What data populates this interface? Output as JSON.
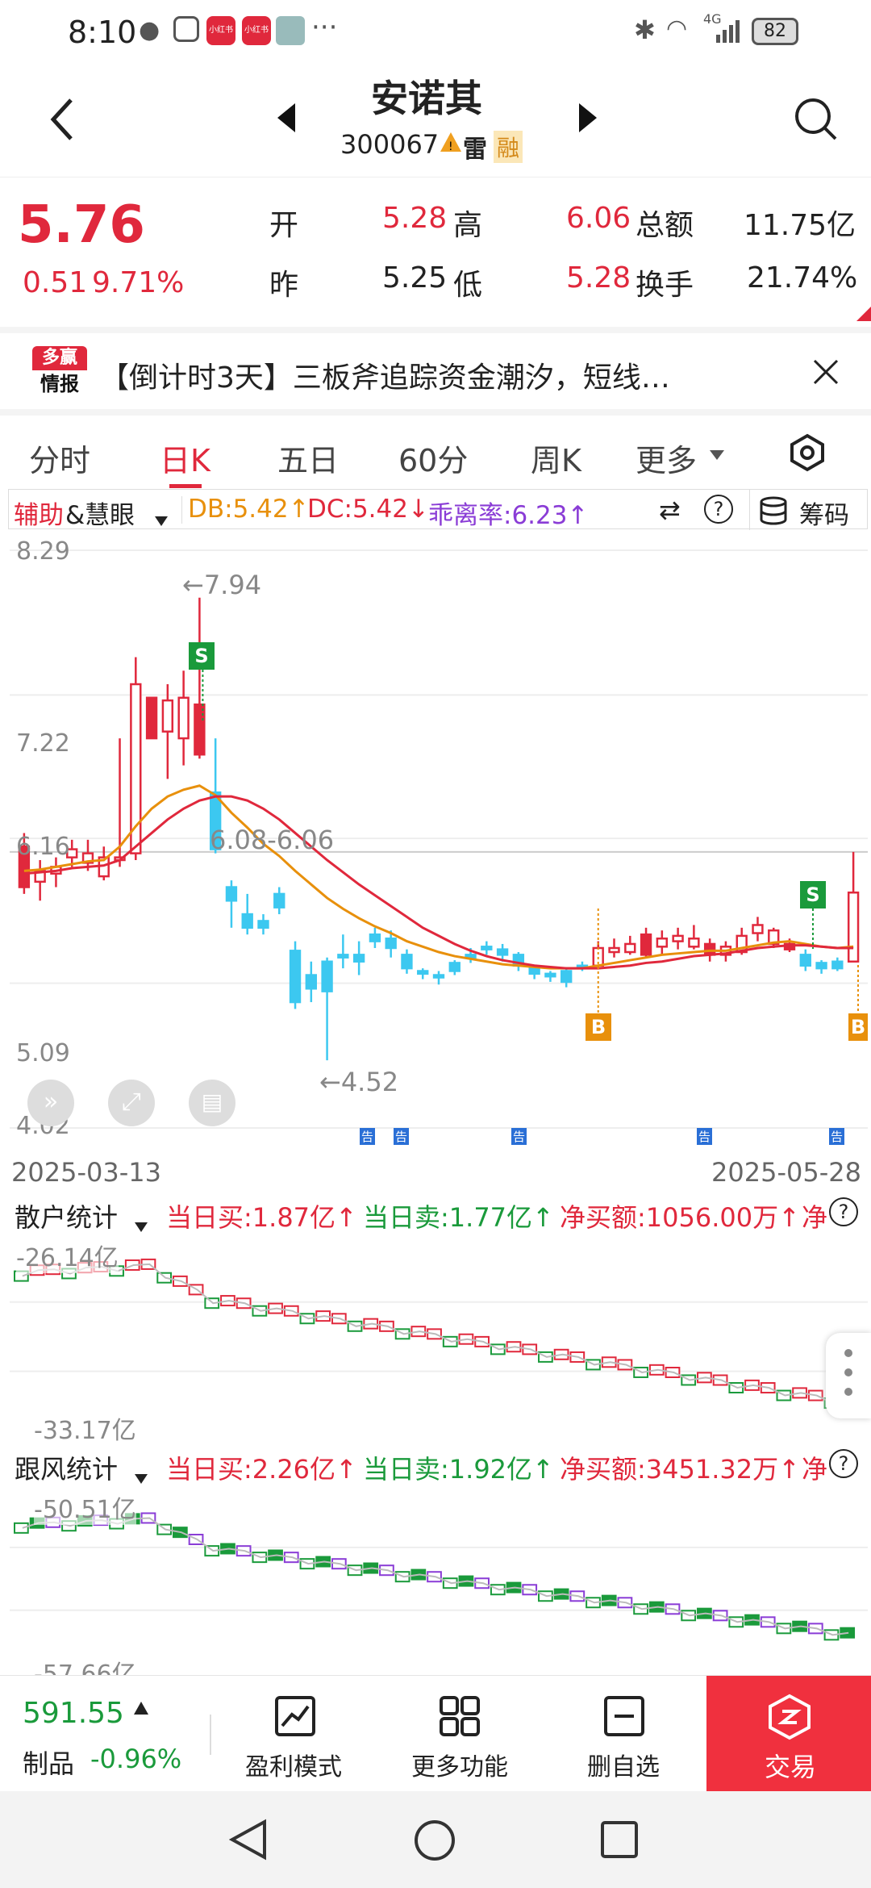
{
  "status": {
    "time": "8:10",
    "battery": "82",
    "signal": "4G",
    "more": "···",
    "app_badge": "小红书"
  },
  "header": {
    "title": "安诺其",
    "code": "300067",
    "tag1": "雷",
    "tag2": "融"
  },
  "quote": {
    "price": "5.76",
    "change": "0.51",
    "change_pct": "9.71%",
    "open_label": "开",
    "open": "5.28",
    "high_label": "高",
    "high": "6.06",
    "amount_label": "总额",
    "amount": "11.75亿",
    "prev_label": "昨",
    "prev": "5.25",
    "low_label": "低",
    "low": "5.28",
    "turnover_label": "换手",
    "turnover": "21.74%"
  },
  "banner": {
    "logo_top": "多赢",
    "logo_bottom": "情报",
    "text": "【倒计时3天】三板斧追踪资金潮汐，短线…"
  },
  "tabs": [
    "分时",
    "日K",
    "五日",
    "60分",
    "周K",
    "更多"
  ],
  "indicator": {
    "name_prefix": "辅助",
    "name_suffix": "&慧眼",
    "db": "DB:5.42↑",
    "dc": "DC:5.42↓",
    "bias": "乖离率:6.23↑",
    "chips": "筹码"
  },
  "chart_data": {
    "type": "candlestick",
    "y_labels": [
      "8.29",
      "7.22",
      "6.16",
      "5.09",
      "4.02"
    ],
    "ylim": [
      4.02,
      8.29
    ],
    "x_start": "2025-03-13",
    "x_end": "2025-05-28",
    "annotations": {
      "high": "←7.94",
      "low": "←4.52",
      "range": "6.08-6.06"
    },
    "signals": [
      "S",
      "B",
      "S",
      "B"
    ],
    "notice_marker": "告",
    "candles": [
      {
        "o": 6.1,
        "c": 5.8,
        "h": 6.2,
        "l": 5.75,
        "up": false,
        "red": true
      },
      {
        "o": 5.84,
        "c": 5.92,
        "h": 6.0,
        "l": 5.7,
        "up": true,
        "red": true
      },
      {
        "o": 5.9,
        "c": 5.95,
        "h": 6.02,
        "l": 5.8,
        "up": true,
        "red": true
      },
      {
        "o": 6.02,
        "c": 6.08,
        "h": 6.15,
        "l": 5.95,
        "up": true,
        "red": true
      },
      {
        "o": 5.98,
        "c": 6.05,
        "h": 6.15,
        "l": 5.92,
        "up": true,
        "red": true
      },
      {
        "o": 5.88,
        "c": 6.02,
        "h": 6.1,
        "l": 5.85,
        "up": true,
        "red": true
      },
      {
        "o": 6.0,
        "c": 6.02,
        "h": 6.9,
        "l": 5.95,
        "up": true,
        "red": true
      },
      {
        "o": 6.05,
        "c": 7.3,
        "h": 7.5,
        "l": 6.0,
        "up": true,
        "red": true
      },
      {
        "o": 7.2,
        "c": 6.9,
        "h": 7.2,
        "l": 6.9,
        "up": false,
        "red": true
      },
      {
        "o": 6.95,
        "c": 7.18,
        "h": 7.3,
        "l": 6.6,
        "up": true,
        "red": true
      },
      {
        "o": 6.9,
        "c": 7.2,
        "h": 7.4,
        "l": 6.7,
        "up": true,
        "red": true
      },
      {
        "o": 7.15,
        "c": 6.78,
        "h": 7.94,
        "l": 6.75,
        "up": false,
        "red": true
      },
      {
        "o": 6.5,
        "c": 6.08,
        "h": 6.9,
        "l": 6.05,
        "up": false,
        "red": false
      },
      {
        "o": 5.8,
        "c": 5.7,
        "h": 5.85,
        "l": 5.5,
        "up": false,
        "red": false
      },
      {
        "o": 5.6,
        "c": 5.5,
        "h": 5.75,
        "l": 5.45,
        "up": false,
        "red": false
      },
      {
        "o": 5.55,
        "c": 5.5,
        "h": 5.6,
        "l": 5.45,
        "up": false,
        "red": false
      },
      {
        "o": 5.75,
        "c": 5.65,
        "h": 5.8,
        "l": 5.6,
        "up": false,
        "red": false
      },
      {
        "o": 5.33,
        "c": 4.95,
        "h": 5.4,
        "l": 4.9,
        "up": false,
        "red": false
      },
      {
        "o": 5.15,
        "c": 5.05,
        "h": 5.25,
        "l": 4.95,
        "up": false,
        "red": false
      },
      {
        "o": 5.25,
        "c": 5.03,
        "h": 5.28,
        "l": 4.52,
        "up": false,
        "red": false
      },
      {
        "o": 5.3,
        "c": 5.28,
        "h": 5.45,
        "l": 5.2,
        "up": false,
        "red": false
      },
      {
        "o": 5.3,
        "c": 5.25,
        "h": 5.4,
        "l": 5.15,
        "up": false,
        "red": false
      },
      {
        "o": 5.45,
        "c": 5.4,
        "h": 5.5,
        "l": 5.35,
        "up": false,
        "red": false
      },
      {
        "o": 5.42,
        "c": 5.35,
        "h": 5.48,
        "l": 5.28,
        "up": false,
        "red": false
      },
      {
        "o": 5.3,
        "c": 5.2,
        "h": 5.34,
        "l": 5.16,
        "up": false,
        "red": false
      },
      {
        "o": 5.18,
        "c": 5.16,
        "h": 5.2,
        "l": 5.12,
        "up": false,
        "red": false
      },
      {
        "o": 5.15,
        "c": 5.14,
        "h": 5.18,
        "l": 5.08,
        "up": false,
        "red": false
      },
      {
        "o": 5.18,
        "c": 5.24,
        "h": 5.26,
        "l": 5.15,
        "up": false,
        "red": false
      },
      {
        "o": 5.28,
        "c": 5.3,
        "h": 5.35,
        "l": 5.24,
        "up": false,
        "red": false
      },
      {
        "o": 5.36,
        "c": 5.34,
        "h": 5.4,
        "l": 5.3,
        "up": false,
        "red": false
      },
      {
        "o": 5.34,
        "c": 5.3,
        "h": 5.38,
        "l": 5.25,
        "up": false,
        "red": false
      },
      {
        "o": 5.3,
        "c": 5.22,
        "h": 5.32,
        "l": 5.18,
        "up": false,
        "red": false
      },
      {
        "o": 5.2,
        "c": 5.16,
        "h": 5.22,
        "l": 5.12,
        "up": false,
        "red": false
      },
      {
        "o": 5.16,
        "c": 5.14,
        "h": 5.18,
        "l": 5.1,
        "up": false,
        "red": false
      },
      {
        "o": 5.18,
        "c": 5.1,
        "h": 5.2,
        "l": 5.06,
        "up": false,
        "red": false
      },
      {
        "o": 5.2,
        "c": 5.22,
        "h": 5.25,
        "l": 5.18,
        "up": false,
        "red": false
      },
      {
        "o": 5.22,
        "c": 5.35,
        "h": 5.4,
        "l": 5.2,
        "up": true,
        "red": true
      },
      {
        "o": 5.35,
        "c": 5.32,
        "h": 5.42,
        "l": 5.28,
        "up": true,
        "red": true
      },
      {
        "o": 5.32,
        "c": 5.38,
        "h": 5.44,
        "l": 5.3,
        "up": true,
        "red": true
      },
      {
        "o": 5.3,
        "c": 5.45,
        "h": 5.5,
        "l": 5.28,
        "up": false,
        "red": true
      },
      {
        "o": 5.36,
        "c": 5.42,
        "h": 5.48,
        "l": 5.3,
        "up": true,
        "red": true
      },
      {
        "o": 5.4,
        "c": 5.44,
        "h": 5.5,
        "l": 5.34,
        "up": true,
        "red": true
      },
      {
        "o": 5.36,
        "c": 5.42,
        "h": 5.52,
        "l": 5.34,
        "up": true,
        "red": true
      },
      {
        "o": 5.38,
        "c": 5.3,
        "h": 5.42,
        "l": 5.25,
        "up": false,
        "red": true
      },
      {
        "o": 5.3,
        "c": 5.36,
        "h": 5.4,
        "l": 5.25,
        "up": true,
        "red": true
      },
      {
        "o": 5.32,
        "c": 5.44,
        "h": 5.5,
        "l": 5.3,
        "up": true,
        "red": true
      },
      {
        "o": 5.46,
        "c": 5.52,
        "h": 5.58,
        "l": 5.4,
        "up": true,
        "red": true
      },
      {
        "o": 5.38,
        "c": 5.48,
        "h": 5.5,
        "l": 5.35,
        "up": true,
        "red": true
      },
      {
        "o": 5.38,
        "c": 5.34,
        "h": 5.42,
        "l": 5.32,
        "up": false,
        "red": true
      },
      {
        "o": 5.3,
        "c": 5.22,
        "h": 5.34,
        "l": 5.18,
        "up": false,
        "red": false
      },
      {
        "o": 5.24,
        "c": 5.2,
        "h": 5.26,
        "l": 5.16,
        "up": false,
        "red": false
      },
      {
        "o": 5.2,
        "c": 5.25,
        "h": 5.28,
        "l": 5.18,
        "up": false,
        "red": false
      },
      {
        "o": 5.25,
        "c": 5.76,
        "h": 6.06,
        "l": 5.25,
        "up": true,
        "red": true
      }
    ],
    "ma_orange": [
      5.92,
      5.93,
      5.95,
      5.97,
      5.99,
      6.0,
      6.1,
      6.25,
      6.38,
      6.47,
      6.52,
      6.55,
      6.48,
      6.35,
      6.24,
      6.12,
      6.03,
      5.92,
      5.82,
      5.72,
      5.64,
      5.57,
      5.51,
      5.46,
      5.4,
      5.36,
      5.32,
      5.29,
      5.27,
      5.25,
      5.23,
      5.22,
      5.21,
      5.2,
      5.2,
      5.2,
      5.22,
      5.24,
      5.26,
      5.28,
      5.3,
      5.31,
      5.32,
      5.33,
      5.33,
      5.35,
      5.37,
      5.39,
      5.4,
      5.38,
      5.36,
      5.35,
      5.36
    ],
    "ma_red": [
      5.9,
      5.91,
      5.92,
      5.94,
      5.95,
      5.96,
      6.0,
      6.1,
      6.2,
      6.3,
      6.38,
      6.44,
      6.47,
      6.47,
      6.44,
      6.38,
      6.3,
      6.2,
      6.1,
      6.0,
      5.91,
      5.82,
      5.74,
      5.66,
      5.58,
      5.5,
      5.44,
      5.38,
      5.33,
      5.29,
      5.26,
      5.24,
      5.22,
      5.21,
      5.2,
      5.2,
      5.2,
      5.21,
      5.22,
      5.24,
      5.25,
      5.27,
      5.29,
      5.3,
      5.31,
      5.33,
      5.35,
      5.36,
      5.37,
      5.37,
      5.36,
      5.35,
      5.35
    ]
  },
  "sub1": {
    "name": "散户统计",
    "buy": "当日买:1.87亿↑",
    "sell": "当日卖:1.77亿↑",
    "net": "净买额:1056.00万↑",
    "net2": "净",
    "top_label": "-26.14亿",
    "bottom_label": "-33.17亿"
  },
  "sub2": {
    "name": "跟风统计",
    "buy": "当日买:2.26亿↑",
    "sell": "当日卖:1.92亿↑",
    "net": "净买额:3451.32万↑",
    "net2": "净",
    "top_label": "-50.51亿",
    "bottom_label": "-57.66亿"
  },
  "bottom": {
    "index_value": "591.55",
    "index_name": "制品",
    "index_change": "-0.96%",
    "btn1": "盈利模式",
    "btn2": "更多功能",
    "btn3": "删自选",
    "btn4": "交易"
  },
  "colors": {
    "up": "#e0283c",
    "down": "#3cc8f0",
    "orange": "#e8900c",
    "green": "#1a9a3b",
    "purple": "#8a3cd6"
  }
}
